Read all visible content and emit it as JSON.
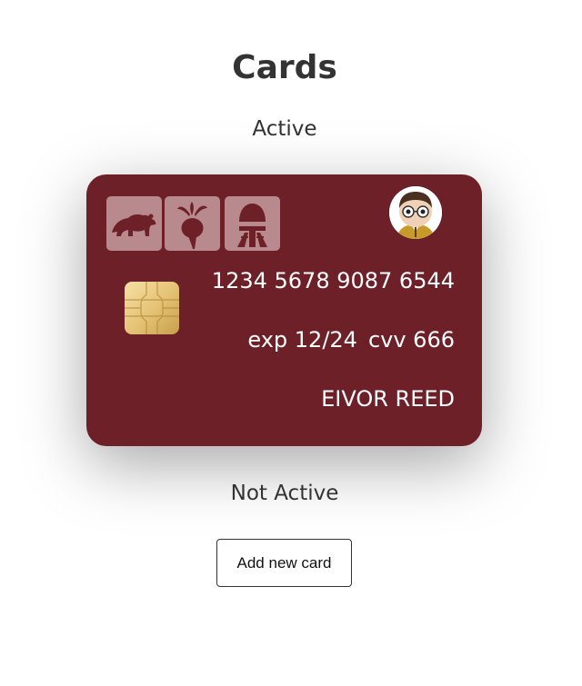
{
  "page": {
    "title": "Cards"
  },
  "sections": {
    "active_label": "Active",
    "inactive_label": "Not Active"
  },
  "card": {
    "number": "1234 5678 9087 6544",
    "exp": "exp 12/24",
    "cvv": "cvv 666",
    "holder": "EIVOR REED",
    "background_color": "#6e2028",
    "icons": [
      "bear-icon",
      "beet-icon",
      "cylon-helmet-icon"
    ],
    "avatar": "avatar"
  },
  "actions": {
    "add_card_label": "Add new card"
  }
}
